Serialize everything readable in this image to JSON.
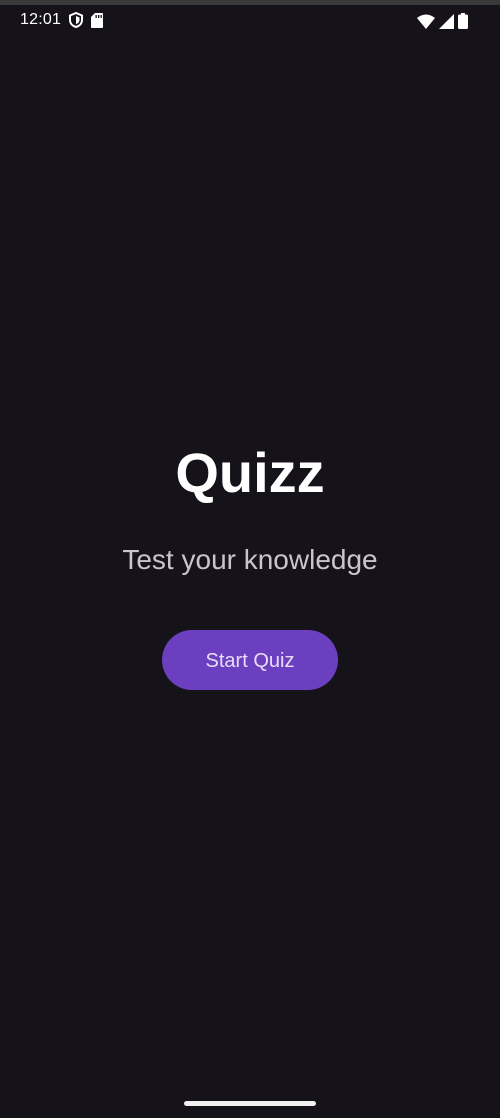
{
  "status_bar": {
    "time": "12:01",
    "icons": [
      "shield-icon",
      "sd-card-icon",
      "wifi-icon",
      "cellular-signal-icon",
      "battery-icon"
    ]
  },
  "main": {
    "title": "Quizz",
    "subtitle": "Test your knowledge",
    "start_button_label": "Start Quiz"
  },
  "colors": {
    "background": "#15121a",
    "title": "#ffffff",
    "subtitle": "#c9c5cf",
    "button_bg": "#6b3fbf",
    "button_text": "#e7ddf7"
  }
}
